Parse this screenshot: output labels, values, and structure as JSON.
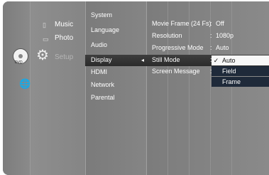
{
  "media": {
    "items": [
      {
        "label": "Music"
      },
      {
        "label": "Photo"
      },
      {
        "label": "Setup"
      }
    ]
  },
  "menu": {
    "items": [
      "System",
      "Language",
      "Audio",
      "Display",
      "HDMI",
      "Network",
      "Parental"
    ],
    "selected": "Display"
  },
  "settings": {
    "rows": [
      {
        "label": "Movie Frame (24 Fs)",
        "value": "Off"
      },
      {
        "label": "Resolution",
        "value": "1080p"
      },
      {
        "label": "Progressive Mode",
        "value": "Auto"
      },
      {
        "label": "Still Mode",
        "value": ""
      },
      {
        "label": "Screen Message",
        "value": ""
      }
    ]
  },
  "still_mode_dropdown": {
    "options": [
      "Auto",
      "Field",
      "Frame"
    ],
    "checked": "Auto"
  },
  "icons": {
    "disc": "disc-icon",
    "disc_label": "DVD",
    "setup": "gear-icon",
    "network": "globe-icon"
  }
}
